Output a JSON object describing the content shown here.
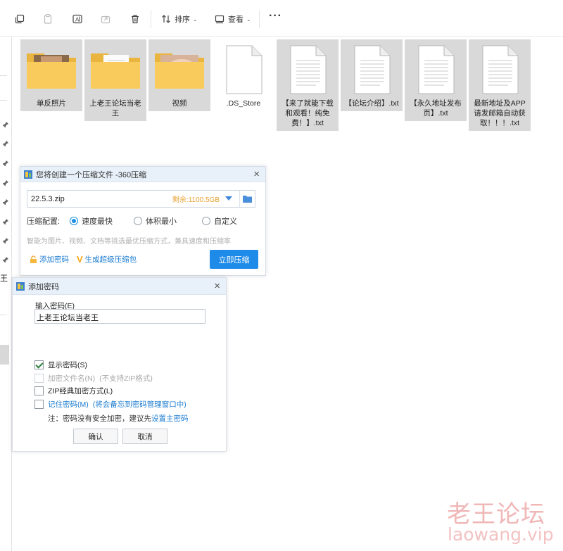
{
  "toolbar": {
    "sort_label": "排序",
    "view_label": "查看",
    "more_label": "···"
  },
  "left_nav": {
    "partial_char": "王"
  },
  "files": [
    {
      "name": "单反照片",
      "kind": "folder-photo"
    },
    {
      "name": "上老王论坛当老王",
      "kind": "folder-doc"
    },
    {
      "name": "视频",
      "kind": "folder-photo"
    },
    {
      "name": ".DS_Store",
      "kind": "blank"
    },
    {
      "name": "【来了就能下载和观看！纯免费！】.txt",
      "kind": "txt"
    },
    {
      "name": "【论坛介绍】.txt",
      "kind": "txt"
    },
    {
      "name": "【永久地址发布页】.txt",
      "kind": "txt"
    },
    {
      "name": "最新地址及APP请发邮箱自动获取！！！.txt",
      "kind": "txt"
    }
  ],
  "compress_dialog": {
    "title": "您将创建一个压缩文件 -360压缩",
    "filename": "22.5.3.zip",
    "free_space": "剩余:1100.5GB",
    "config_label": "压缩配置:",
    "options": [
      "速度最快",
      "体积最小",
      "自定义"
    ],
    "selected_option": "速度最快",
    "hint": "智能为图片、视频、文档等挑选最优压缩方式，兼具速度和压缩率",
    "add_password_link": "添加密码",
    "super_pack_link": "生成超级压缩包",
    "compress_button": "立即压缩"
  },
  "password_dialog": {
    "title": "添加密码",
    "input_label": "输入密码(E)",
    "password_value": "上老王论坛当老王",
    "show_password": {
      "label": "显示密码(S)",
      "checked": true
    },
    "encrypt_names": {
      "label": "加密文件名(N)",
      "note": "(不支持ZIP格式)",
      "checked": false,
      "disabled": true
    },
    "zip_classic": {
      "label": "ZIP经典加密方式(L)",
      "checked": false
    },
    "remember": {
      "label": "记住密码(M)",
      "note": "(将会备忘到密码管理窗口中)",
      "checked": false
    },
    "footer_note": "注：密码没有安全加密，建议先",
    "footer_link": "设置主密码",
    "ok_button": "确认",
    "cancel_button": "取消"
  },
  "watermark": {
    "line1": "老王论坛",
    "line2": "laowang.vip"
  },
  "colors": {
    "accent": "#1f8be8",
    "tile_selected": "#d9d9d9",
    "link": "#1b7cd1"
  }
}
